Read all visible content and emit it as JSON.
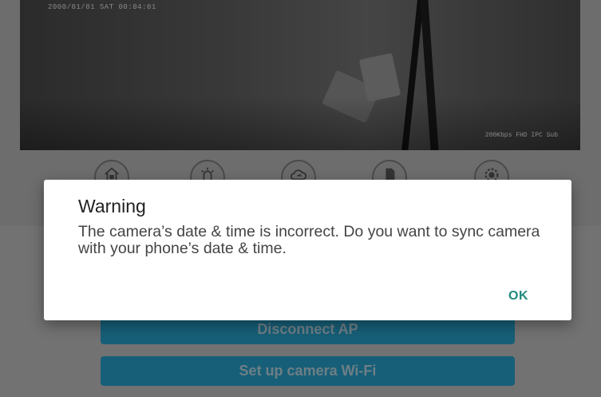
{
  "camera": {
    "osd_timestamp": "2000/01/01  SAT 00:04:01",
    "osd_bitrate": "200Kbps FHD IPC Sub"
  },
  "icons": [
    "home-icon",
    "alarm-light-icon",
    "cloud-sync-icon",
    "sd-card-icon",
    "settings-icon"
  ],
  "buttons": {
    "disconnect_ap": "Disconnect AP",
    "setup_wifi": "Set up camera Wi-Fi"
  },
  "dialog": {
    "title": "Warning",
    "message": "The camera’s date & time is incorrect. Do you want to sync camera with your phone’s date & time.",
    "ok_label": "OK"
  },
  "colors": {
    "accent_teal": "#1f8a7d",
    "button_blue": "#175f78",
    "scrim_gray": "#6d6d6d"
  }
}
